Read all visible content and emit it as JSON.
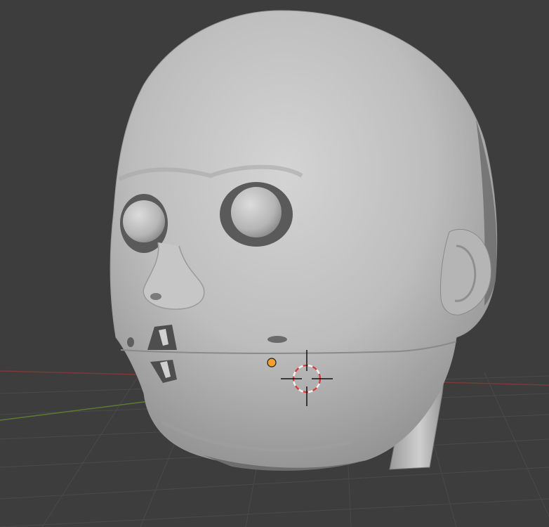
{
  "viewport": {
    "background_color": "#3d3d3d",
    "grid_color": "#4a4a4a",
    "x_axis_color": "#7a3a3a",
    "y_axis_color": "#5f7a2e"
  },
  "scene": {
    "mesh_color": "#bdbdbd",
    "mesh_shadow_color": "#8f8f8f",
    "mesh_highlight_color": "#d4d4d4",
    "eye_color": "#c4c4c4",
    "socket_color": "#5a5a5a"
  },
  "overlays": {
    "origin_color": "#f29f2c",
    "cursor_ring_color": "#d04040",
    "cursor_ring_alt_color": "#f0f0f0",
    "cursor_cross_color": "#111111",
    "origin_icon": "object-origin-icon",
    "cursor_icon": "3d-cursor-icon"
  }
}
